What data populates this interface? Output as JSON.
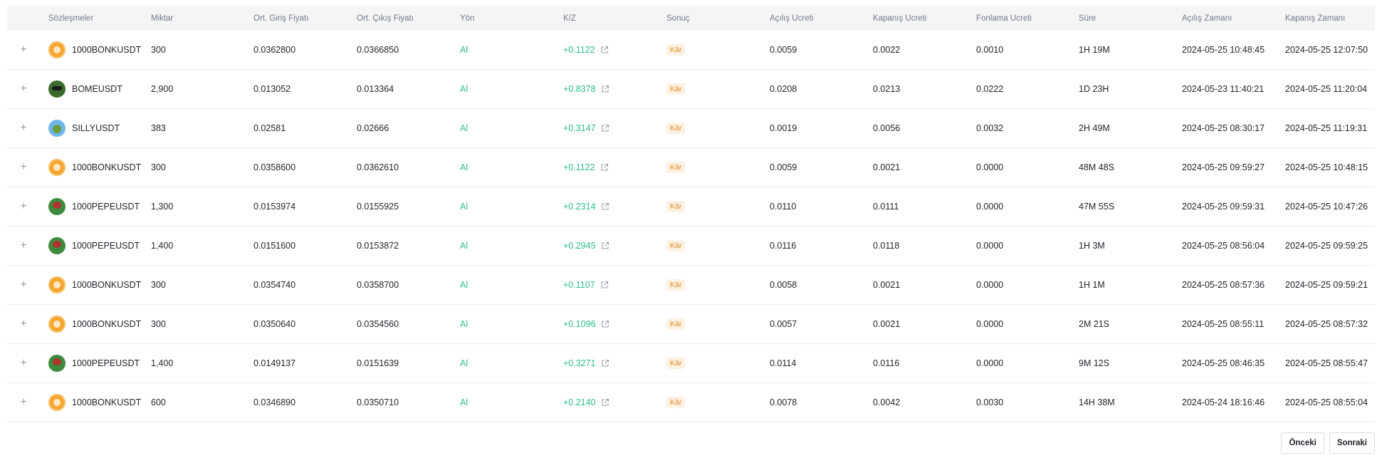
{
  "columns": {
    "contract": "Sözleşmeler",
    "quantity": "Miktar",
    "entry_price": "Ort. Giriş Fiyatı",
    "exit_price": "Ort. Çıkış Fiyatı",
    "direction": "Yön",
    "pnl": "K/Z",
    "result": "Sonuç",
    "open_fee": "Açılış Ücreti",
    "close_fee": "Kapanış Ücreti",
    "funding_fee": "Fonlama Ücreti",
    "duration": "Süre",
    "open_time": "Açılış Zamanı",
    "close_time": "Kapanış Zamanı"
  },
  "expand_symbol": "+",
  "icons": {
    "expand": "plus-icon",
    "pnl_link": "external-link-icon"
  },
  "colors": {
    "profit": "#2ebd85",
    "badge_text": "#e08a1e",
    "badge_bg": "#fdf1e4"
  },
  "rows": [
    {
      "coin": "bonk",
      "symbol": "1000BONKUSDT",
      "quantity": "300",
      "entry": "0.0362800",
      "exit": "0.0366850",
      "direction": "Al",
      "pnl": "+0.1122",
      "result": "Kâr",
      "open_fee": "0.0059",
      "close_fee": "0.0022",
      "funding_fee": "0.0010",
      "duration": "1H 19M",
      "open_time": "2024-05-25 10:48:45",
      "close_time": "2024-05-25 12:07:50"
    },
    {
      "coin": "bome",
      "symbol": "BOMEUSDT",
      "quantity": "2,900",
      "entry": "0.013052",
      "exit": "0.013364",
      "direction": "Al",
      "pnl": "+0.8378",
      "result": "Kâr",
      "open_fee": "0.0208",
      "close_fee": "0.0213",
      "funding_fee": "0.0222",
      "duration": "1D 23H",
      "open_time": "2024-05-23 11:40:21",
      "close_time": "2024-05-25 11:20:04"
    },
    {
      "coin": "silly",
      "symbol": "SILLYUSDT",
      "quantity": "383",
      "entry": "0.02581",
      "exit": "0.02666",
      "direction": "Al",
      "pnl": "+0.3147",
      "result": "Kâr",
      "open_fee": "0.0019",
      "close_fee": "0.0056",
      "funding_fee": "0.0032",
      "duration": "2H 49M",
      "open_time": "2024-05-25 08:30:17",
      "close_time": "2024-05-25 11:19:31"
    },
    {
      "coin": "bonk",
      "symbol": "1000BONKUSDT",
      "quantity": "300",
      "entry": "0.0358600",
      "exit": "0.0362610",
      "direction": "Al",
      "pnl": "+0.1122",
      "result": "Kâr",
      "open_fee": "0.0059",
      "close_fee": "0.0021",
      "funding_fee": "0.0000",
      "duration": "48M 48S",
      "open_time": "2024-05-25 09:59:27",
      "close_time": "2024-05-25 10:48:15"
    },
    {
      "coin": "pepe",
      "symbol": "1000PEPEUSDT",
      "quantity": "1,300",
      "entry": "0.0153974",
      "exit": "0.0155925",
      "direction": "Al",
      "pnl": "+0.2314",
      "result": "Kâr",
      "open_fee": "0.0110",
      "close_fee": "0.0111",
      "funding_fee": "0.0000",
      "duration": "47M 55S",
      "open_time": "2024-05-25 09:59:31",
      "close_time": "2024-05-25 10:47:26"
    },
    {
      "coin": "pepe",
      "symbol": "1000PEPEUSDT",
      "quantity": "1,400",
      "entry": "0.0151600",
      "exit": "0.0153872",
      "direction": "Al",
      "pnl": "+0.2945",
      "result": "Kâr",
      "open_fee": "0.0116",
      "close_fee": "0.0118",
      "funding_fee": "0.0000",
      "duration": "1H 3M",
      "open_time": "2024-05-25 08:56:04",
      "close_time": "2024-05-25 09:59:25"
    },
    {
      "coin": "bonk",
      "symbol": "1000BONKUSDT",
      "quantity": "300",
      "entry": "0.0354740",
      "exit": "0.0358700",
      "direction": "Al",
      "pnl": "+0.1107",
      "result": "Kâr",
      "open_fee": "0.0058",
      "close_fee": "0.0021",
      "funding_fee": "0.0000",
      "duration": "1H 1M",
      "open_time": "2024-05-25 08:57:36",
      "close_time": "2024-05-25 09:59:21"
    },
    {
      "coin": "bonk",
      "symbol": "1000BONKUSDT",
      "quantity": "300",
      "entry": "0.0350640",
      "exit": "0.0354560",
      "direction": "Al",
      "pnl": "+0.1096",
      "result": "Kâr",
      "open_fee": "0.0057",
      "close_fee": "0.0021",
      "funding_fee": "0.0000",
      "duration": "2M 21S",
      "open_time": "2024-05-25 08:55:11",
      "close_time": "2024-05-25 08:57:32"
    },
    {
      "coin": "pepe",
      "symbol": "1000PEPEUSDT",
      "quantity": "1,400",
      "entry": "0.0149137",
      "exit": "0.0151639",
      "direction": "Al",
      "pnl": "+0.3271",
      "result": "Kâr",
      "open_fee": "0.0114",
      "close_fee": "0.0116",
      "funding_fee": "0.0000",
      "duration": "9M 12S",
      "open_time": "2024-05-25 08:46:35",
      "close_time": "2024-05-25 08:55:47"
    },
    {
      "coin": "bonk",
      "symbol": "1000BONKUSDT",
      "quantity": "600",
      "entry": "0.0346890",
      "exit": "0.0350710",
      "direction": "Al",
      "pnl": "+0.2140",
      "result": "Kâr",
      "open_fee": "0.0078",
      "close_fee": "0.0042",
      "funding_fee": "0.0030",
      "duration": "14H 38M",
      "open_time": "2024-05-24 18:16:46",
      "close_time": "2024-05-25 08:55:04"
    }
  ],
  "pagination": {
    "prev_label": "Önceki",
    "next_label": "Sonraki"
  }
}
